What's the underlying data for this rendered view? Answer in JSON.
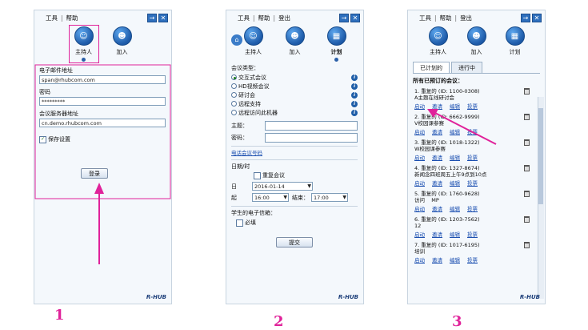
{
  "panel1": {
    "menu": {
      "tools": "工具",
      "sep": "|",
      "help": "帮助"
    },
    "icons": [
      {
        "label": "主持人",
        "name": "host-icon"
      },
      {
        "label": "加入",
        "name": "join-icon"
      }
    ],
    "email_label": "电子邮件地址",
    "email_value": "span@rhubcom.com",
    "password_label": "密码",
    "password_value": "*********",
    "server_label": "会议服务器地址",
    "server_value": "cn.demo.rhubcom.com",
    "save_label": "保存设置",
    "login_label": "登录",
    "brand": "R-HUB",
    "step": "1"
  },
  "panel2": {
    "menu": {
      "tools": "工具",
      "sep": "|",
      "help": "帮助",
      "sep2": "|",
      "logout": "登出"
    },
    "icons": [
      {
        "label": "主持人"
      },
      {
        "label": "加入"
      },
      {
        "label": "计划"
      }
    ],
    "meeting_type_label": "会议类型：",
    "meeting_types": [
      "交互式会议",
      "HD视频会议",
      "研讨会",
      "远程支持",
      "远程访问此机器"
    ],
    "topic_label": "主题：",
    "password_label": "密码：",
    "phone_link": "电话会议号码",
    "datetime_label": "日期/时",
    "recurring_label": "重复会议",
    "date_label": "日",
    "date_value": "2016-01-14",
    "start_label": "起",
    "start_value": "16:00",
    "end_label": "结束：",
    "end_value": "17:00",
    "student_email_label": "学生的电子信箱：",
    "required_label": "必填",
    "submit_label": "提交",
    "brand": "R-HUB",
    "step": "2"
  },
  "panel3": {
    "menu": {
      "tools": "工具",
      "sep": "|",
      "help": "帮助",
      "sep2": "|",
      "logout": "登出"
    },
    "icons": [
      {
        "label": "主持人"
      },
      {
        "label": "加入"
      },
      {
        "label": "计划"
      }
    ],
    "tabs": [
      "已计划的",
      "进行中"
    ],
    "list_title": "所有已预订的会议：",
    "meetings": [
      {
        "title": "1. 重复的 (ID: 1100-0308)",
        "subject": "A主题在线研讨会",
        "links": [
          "启动",
          "邀请",
          "编辑",
          "投票"
        ]
      },
      {
        "title": "2. 重复的 (ID: 6662-9999)",
        "subject": "V校园课参赛",
        "links": [
          "启动",
          "邀请",
          "编辑",
          "投票"
        ]
      },
      {
        "title": "3. 重复的 (ID: 1018-1322)",
        "subject": "W校园课参赛",
        "links": [
          "启动",
          "邀请",
          "编辑",
          "投票"
        ]
      },
      {
        "title": "4. 重复的 (ID: 1327-8674)",
        "subject": "新闻念四班周五上午9点到10点",
        "links": [
          "启动",
          "邀请",
          "编辑",
          "投票"
        ]
      },
      {
        "title": "5. 重复的 (ID: 1760-9628)",
        "subject": "访问    MP",
        "links": [
          "启动",
          "邀请",
          "编辑",
          "投票"
        ]
      },
      {
        "title": "6. 重复的 (ID: 1203-7562)",
        "subject": "12",
        "links": [
          "启动",
          "邀请",
          "编辑",
          "投票"
        ]
      },
      {
        "title": "7. 重复的 (ID: 1017-6195)",
        "subject": "培训",
        "links": [
          "启动",
          "邀请",
          "编辑",
          "投票"
        ]
      }
    ],
    "brand": "R-HUB",
    "step": "3"
  },
  "colors": {
    "accent": "#e0229a",
    "brand_blue": "#2e6fbd"
  }
}
